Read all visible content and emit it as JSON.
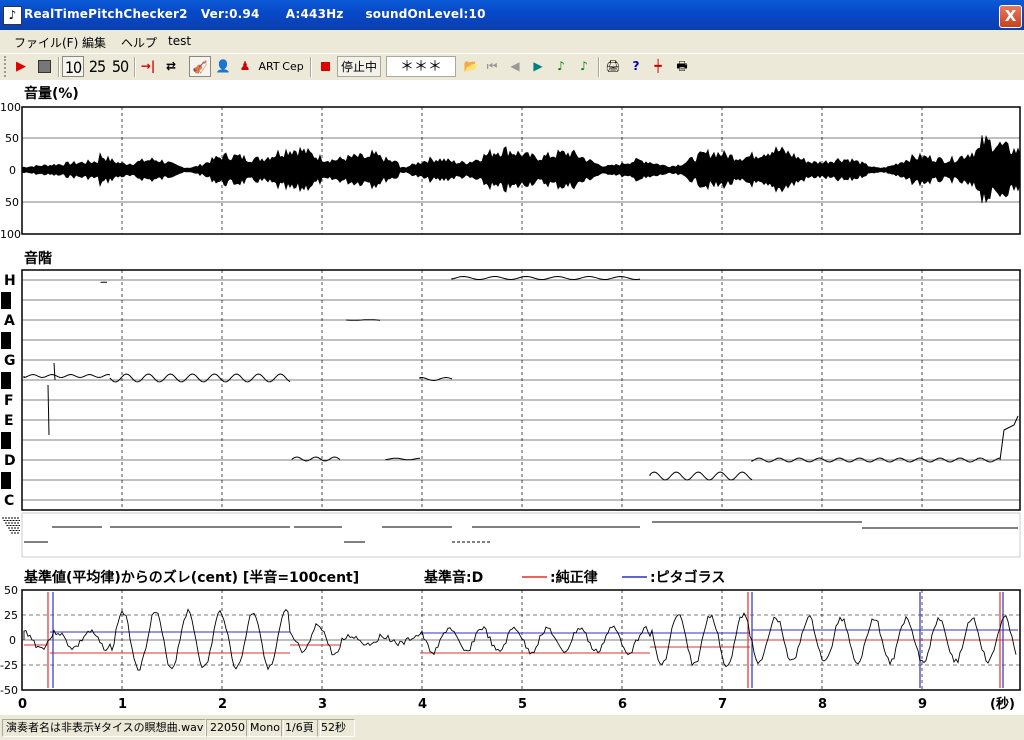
{
  "window": {
    "title": "RealTimePitchChecker2   Ver:0.94      A:443Hz     soundOnLevel:10",
    "close_glyph": "X"
  },
  "menu": [
    "ファイル(F)",
    "編集",
    "ヘルプ",
    "test"
  ],
  "toolbar": {
    "numbers": [
      "10",
      "25",
      "50"
    ],
    "art": "ART",
    "cep": "Cep",
    "status": "停止中",
    "note_display": "＊＊＊"
  },
  "volume_panel": {
    "title": "音量(%)",
    "yticks": [
      "100",
      "50",
      "0",
      "50",
      "100"
    ]
  },
  "scale_panel": {
    "title": "音階",
    "notes": [
      "H",
      "A",
      "G",
      "F",
      "E",
      "D",
      "C"
    ]
  },
  "cent_panel": {
    "title": "基準値(平均律)からのズレ(cent) [半音=100cent]",
    "base_note": "基準音:D",
    "just_label": ":純正律",
    "pyth_label": ":ピタゴラス",
    "just_color": "#e03030",
    "pyth_color": "#3030c0",
    "yticks": [
      "50",
      "25",
      "0",
      "-25",
      "-50"
    ]
  },
  "time_axis": {
    "ticks": [
      "0",
      "1",
      "2",
      "3",
      "4",
      "5",
      "6",
      "7",
      "8",
      "9"
    ],
    "unit": "(秒)"
  },
  "status": {
    "file": "演奏者名は非表示¥タイスの瞑想曲.wav",
    "rate": "22050",
    "mode": "Mono",
    "page": "1/6頁",
    "length": "52秒"
  }
}
